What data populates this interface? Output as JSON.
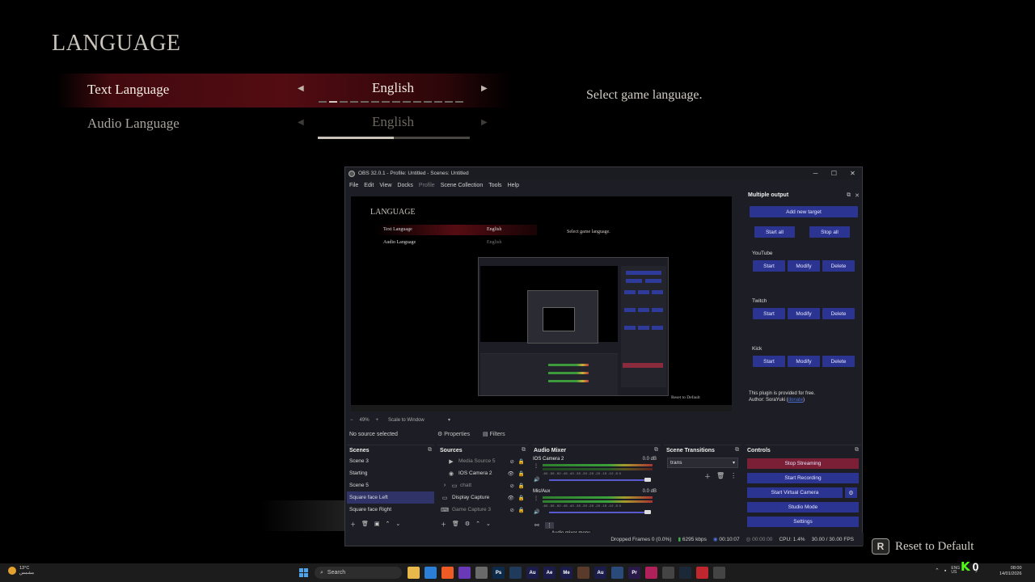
{
  "game": {
    "title": "LANGUAGE",
    "rows": [
      {
        "label": "Text Language",
        "value": "English",
        "left_arrow": "◀",
        "right_arrow": "▶"
      },
      {
        "label": "Audio Language",
        "value": "English",
        "left_arrow": "◀",
        "right_arrow": "▶"
      }
    ],
    "audio_progress_fraction": 0.5,
    "description": "Select game language.",
    "reset": {
      "key": "R",
      "label": "Reset to Default"
    }
  },
  "obs": {
    "title": "OBS 32.0.1 - Profile: Untitled - Scenes: Untitled",
    "window_buttons": [
      "─",
      "☐",
      "✕"
    ],
    "menu": [
      "File",
      "Edit",
      "View",
      "Docks",
      "Profile",
      "Scene Collection",
      "Tools",
      "Help"
    ],
    "preview": {
      "title": "LANGUAGE",
      "row1_label": "Text Language",
      "row1_value": "English",
      "row2_label": "Audio Language",
      "row2_value": "English",
      "description": "Select game language.",
      "reset": "Reset to Default"
    },
    "zoom": {
      "minus": "−",
      "level": "49%",
      "plus": "+",
      "fit": "Scale to Window"
    },
    "source_bar": {
      "no_source": "No source selected",
      "properties": "Properties",
      "filters": "Filters"
    },
    "multiple_output": {
      "header": "Multiple output",
      "add_target": "Add new target",
      "start_all": "Start all",
      "stop_all": "Stop all",
      "platforms": [
        {
          "name": "YouTube",
          "start": "Start",
          "modify": "Modify",
          "delete": "Delete"
        },
        {
          "name": "Twitch",
          "start": "Start",
          "modify": "Modify",
          "delete": "Delete"
        },
        {
          "name": "Kick",
          "start": "Start",
          "modify": "Modify",
          "delete": "Delete"
        }
      ],
      "note_line1": "This plugin is provided for free.",
      "note_author": "Author: SoraYuki (",
      "note_link": "donate",
      "note_end": ")"
    },
    "scenes": {
      "header": "Scenes",
      "items": [
        "Scene 3",
        "Starting",
        "Scene 5",
        "Square face Left",
        "Square face Right"
      ]
    },
    "sources": {
      "header": "Sources",
      "items": [
        "Media Source 5",
        "IOS Camera 2",
        "chatt",
        "Display Capture",
        "Game Capture 3"
      ]
    },
    "mixer": {
      "header": "Audio Mixer",
      "channels": [
        {
          "name": "IOS Camera 2",
          "db": "0.0 dB"
        },
        {
          "name": "Mic/Aux",
          "db": "0.0 dB"
        }
      ],
      "scale": "-60 -55 -50 -45 -40 -35 -30 -25 -20 -15 -10 -5 0",
      "tooltip": "Audio mixer menu"
    },
    "transitions": {
      "header": "Scene Transitions",
      "selected": "trans"
    },
    "controls": {
      "header": "Controls",
      "stop_streaming": "Stop Streaming",
      "start_recording": "Start Recording",
      "start_virtual_camera": "Start Virtual Camera",
      "studio_mode": "Studio Mode",
      "settings": "Settings"
    },
    "status": {
      "dropped": "Dropped Frames 0 (0.0%)",
      "bitrate": "6295 kbps",
      "stream_time": "00:10:07",
      "rec_time": "00:00:00",
      "cpu": "CPU: 1.4%",
      "fps": "30.00 / 30.00 FPS"
    }
  },
  "taskbar": {
    "temp": "13°C",
    "weather": "مشمس",
    "search": "Search",
    "apps": [
      {
        "label": "",
        "color": "#e8b84a"
      },
      {
        "label": "",
        "color": "#2b7fd6"
      },
      {
        "label": "",
        "color": "#ef5b25"
      },
      {
        "label": "",
        "color": "#6a39b8"
      },
      {
        "label": "",
        "color": "#6a6a6a"
      },
      {
        "label": "Ps",
        "color": "#0d2a4a"
      },
      {
        "label": "",
        "color": "#1f3a5a"
      },
      {
        "label": "Au",
        "color": "#1b1c4a"
      },
      {
        "label": "Ae",
        "color": "#1b1c4a"
      },
      {
        "label": "Me",
        "color": "#1b1c4a"
      },
      {
        "label": "",
        "color": "#5a3a2a"
      },
      {
        "label": "Au",
        "color": "#1b1c4a"
      },
      {
        "label": "",
        "color": "#2a4a7a"
      },
      {
        "label": "Pr",
        "color": "#2a1a4a"
      },
      {
        "label": "",
        "color": "#b0205a"
      },
      {
        "label": "",
        "color": "#444444"
      },
      {
        "label": "",
        "color": "#1b2838"
      },
      {
        "label": "",
        "color": "#c0262d"
      },
      {
        "label": "",
        "color": "#444444"
      }
    ],
    "lang_line1": "ENG",
    "lang_line2": "US",
    "time": "08:00",
    "date": "14/01/2026"
  },
  "kick_overlay": {
    "count": "0"
  }
}
